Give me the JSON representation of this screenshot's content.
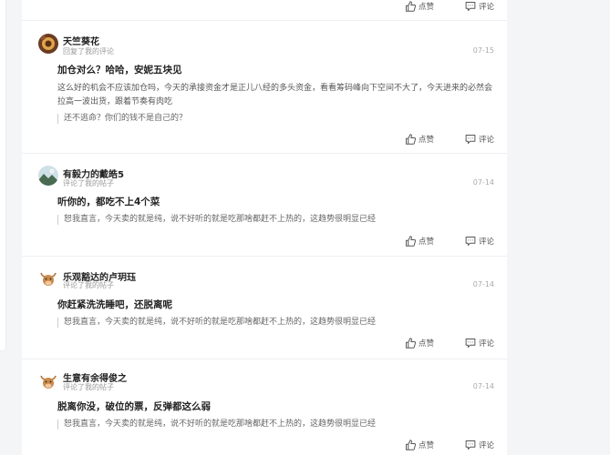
{
  "top_actions": {
    "like_label": "点赞",
    "comment_label": "评论"
  },
  "comments": [
    {
      "username": "天竺葵花",
      "subline": "回复了我的评论",
      "date": "07-15",
      "reply_title": "加仓对么？哈哈，安妮五块见",
      "reply_body": "这么好的机会不应该加仓吗，今天的承接资金才是正儿八经的多头资金，看看筹码峰向下空间不大了，今天进来的必然会拉高一波出货，跟着节奏有肉吃",
      "quote": "还不逃命？你们的钱不是自己的？",
      "like_label": "点赞",
      "comment_label": "评论",
      "avatar_icon": "sunflower-avatar-icon"
    },
    {
      "username": "有毅力的戴皓5",
      "subline": "评论了我的帖子",
      "date": "07-14",
      "reply_title": "听你的，都吃不上4个菜",
      "quote": "恕我直言，今天卖的就是纯，说不好听的就是吃那啥都赶不上热的，这趋势很明显已经",
      "like_label": "点赞",
      "comment_label": "评论",
      "avatar_icon": "landscape-avatar-icon"
    },
    {
      "username": "乐观豁达的卢玥珏",
      "subline": "评论了我的帖子",
      "date": "07-14",
      "reply_title": "你赶紧洗洗睡吧，还脱离呢",
      "quote": "恕我直言，今天卖的就是纯，说不好听的就是吃那啥都赶不上热的，这趋势很明显已经",
      "like_label": "点赞",
      "comment_label": "评论",
      "avatar_icon": "bull-avatar-icon"
    },
    {
      "username": "生意有余得俊之",
      "subline": "评论了我的帖子",
      "date": "07-14",
      "reply_title": "脱离你没，破位的票，反弹都这么弱",
      "quote": "恕我直言，今天卖的就是纯，说不好听的就是吃那啥都赶不上热的，这趋势很明显已经",
      "like_label": "点赞",
      "comment_label": "评论",
      "avatar_icon": "bull-avatar-icon"
    }
  ],
  "colors": {
    "background": "#f4f5f7",
    "card": "#ffffff",
    "divider": "#f0f0f0",
    "quote_border": "#cccccc"
  }
}
